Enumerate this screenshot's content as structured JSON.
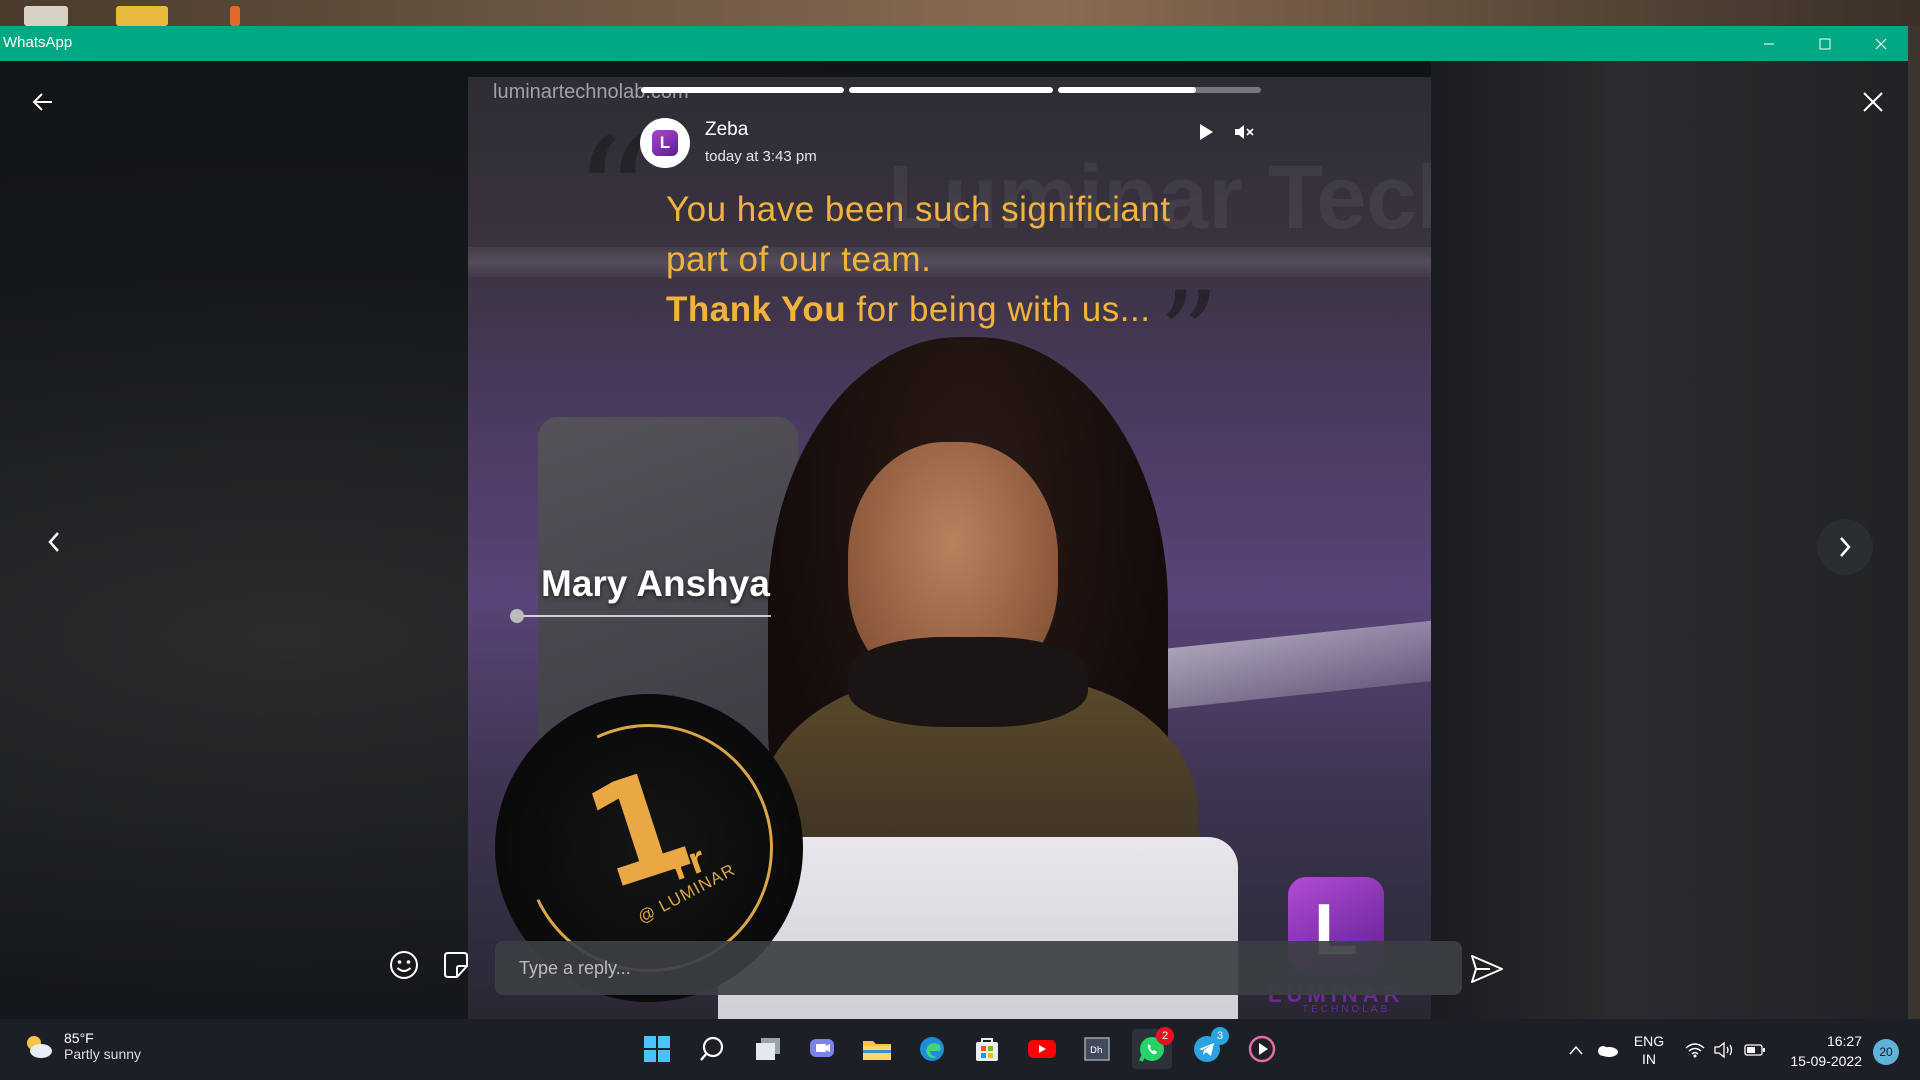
{
  "window": {
    "title": "WhatsApp",
    "accent": "#00a884"
  },
  "status": {
    "contact_name": "Zeba",
    "timestamp": "today at 3:43 pm",
    "progress": [
      1.0,
      1.0,
      0.68
    ],
    "image": {
      "watermark_url": "luminartechnolab.com",
      "watermark_big": "Luminar Tech",
      "quote_line1": "You have been such significiant",
      "quote_line2": "part of our team.",
      "quote_line3_bold": "Thank You",
      "quote_line3_rest": " for being with us...",
      "person_name": "Mary Anshya",
      "badge_number": "1",
      "badge_unit": "Yr",
      "badge_org": "@ LUMINAR",
      "logo_letter": "L",
      "logo_word": "LUMINAR",
      "logo_sub": "TECHNOLAB",
      "avatar_letter": "L"
    }
  },
  "reply": {
    "placeholder": "Type a reply..."
  },
  "taskbar": {
    "weather_temp": "85°F",
    "weather_desc": "Partly sunny",
    "whatsapp_badge": "2",
    "telegram_badge": "3",
    "lang_line1": "ENG",
    "lang_line2": "IN",
    "time": "16:27",
    "date": "15-09-2022",
    "notifications": "20"
  },
  "icons": [
    "back-arrow-icon",
    "close-icon",
    "play-icon",
    "mute-icon",
    "chevron-left-icon",
    "chevron-right-icon",
    "emoji-icon",
    "sticker-icon",
    "send-icon"
  ]
}
